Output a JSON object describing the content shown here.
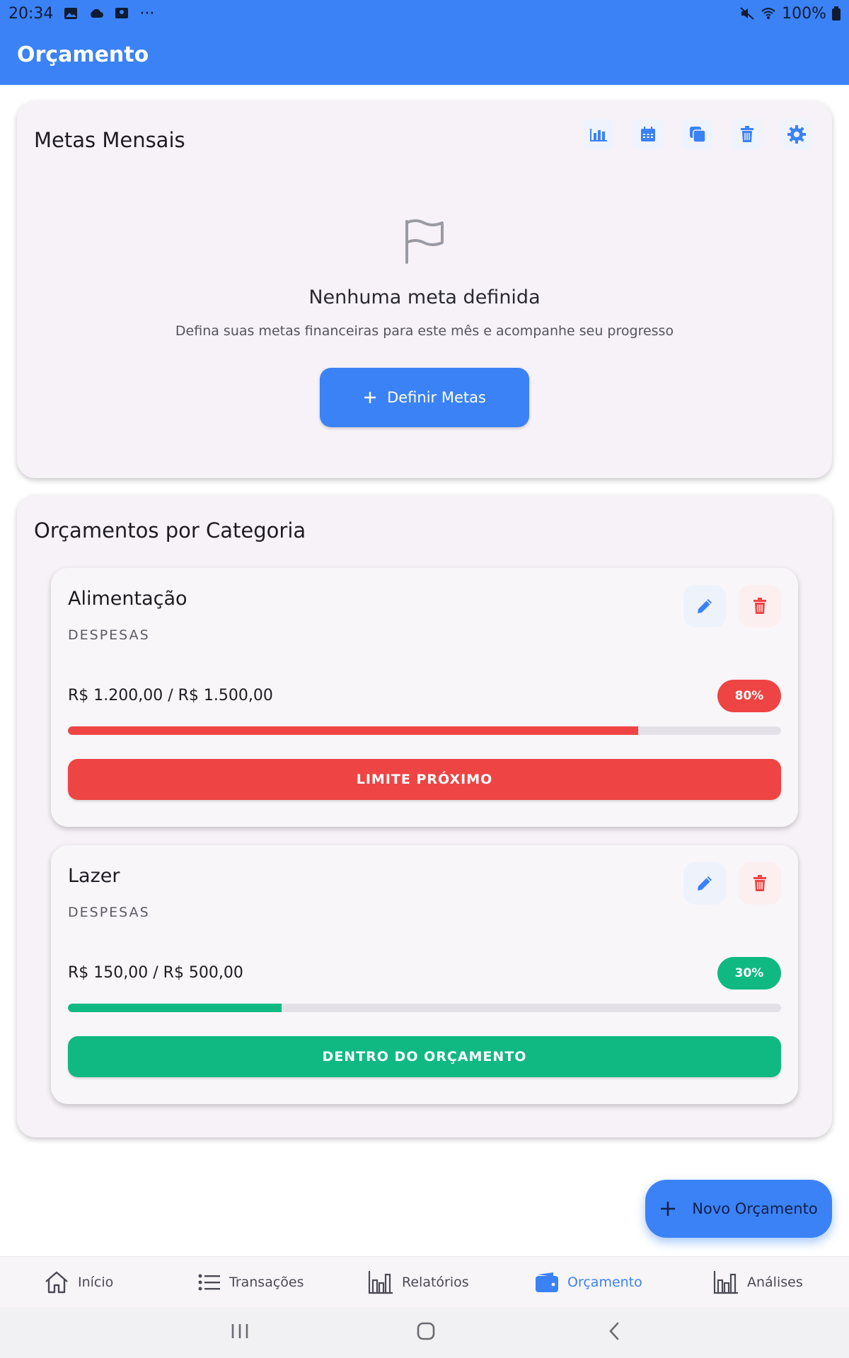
{
  "statusbar": {
    "time": "20:34",
    "battery": "100%"
  },
  "appbar": {
    "title": "Orçamento"
  },
  "goals": {
    "title": "Metas Mensais",
    "empty_title": "Nenhuma meta definida",
    "empty_subtitle": "Defina suas metas financeiras para este mês e acompanhe seu progresso",
    "define_label": "Definir Metas"
  },
  "categories": {
    "title": "Orçamentos por Categoria",
    "items": [
      {
        "name": "Alimentação",
        "type": "DESPESAS",
        "amount": "R$ 1.200,00 / R$ 1.500,00",
        "percent": "80%",
        "progress": 0.8,
        "status": "LIMITE PRÓXIMO",
        "color": "#ef4444"
      },
      {
        "name": "Lazer",
        "type": "DESPESAS",
        "amount": "R$ 150,00 / R$ 500,00",
        "percent": "30%",
        "progress": 0.3,
        "status": "DENTRO DO ORÇAMENTO",
        "color": "#10b981"
      }
    ]
  },
  "fab": {
    "label": "Novo Orçamento"
  },
  "nav": {
    "items": [
      {
        "label": "Início",
        "icon": "home-icon"
      },
      {
        "label": "Transações",
        "icon": "list-icon"
      },
      {
        "label": "Relatórios",
        "icon": "bar-chart-icon"
      },
      {
        "label": "Orçamento",
        "icon": "wallet-icon",
        "active": true
      },
      {
        "label": "Análises",
        "icon": "bar-chart-icon"
      }
    ]
  },
  "colors": {
    "primary": "#3b82f6",
    "danger": "#ef4444",
    "success": "#10b981"
  }
}
